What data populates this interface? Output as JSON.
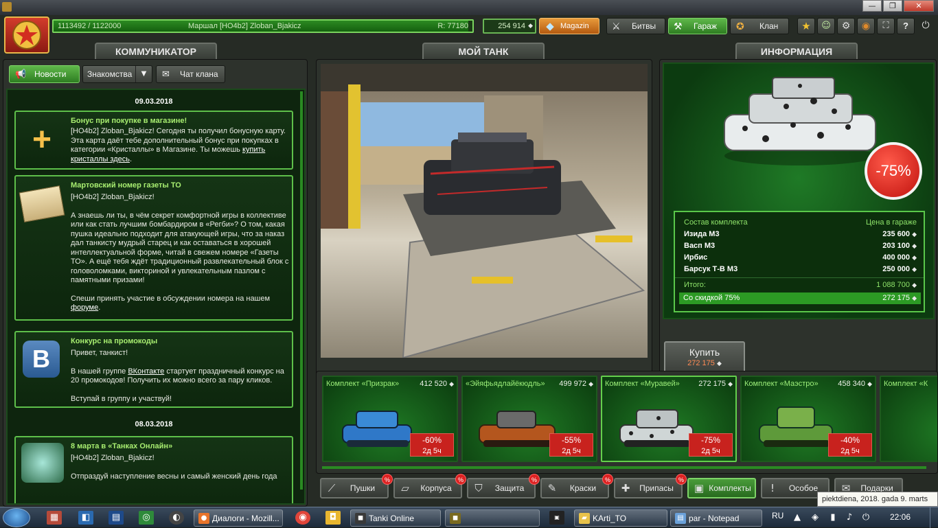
{
  "window": {
    "min_glyph": "—",
    "max_glyph": "❐",
    "close_glyph": "✕"
  },
  "topbar": {
    "rank_progress": "1113492 / 1122000",
    "rank_name": "Маршал [НО4b2] Zloban_Bjakicz",
    "rating": "R: 77180",
    "crystals": "254 914",
    "shop_label": "Magazin",
    "battles_label": "Битвы",
    "garage_label": "Гараж",
    "clan_label": "Клан",
    "help_label": "?"
  },
  "communicator": {
    "title": "КОММУНИКАТОР",
    "tab_news": "Новости",
    "tab_acquaint": "Знакомства",
    "tab_clanchat": "Чат клана",
    "date1": "09.03.2018",
    "date2": "08.03.2018",
    "news": [
      {
        "title": "Бонус при покупке в магазине!",
        "body": "[НО4b2] Zloban_Bjakicz! Сегодня ты получил бонусную карту. Эта карта даёт тебе дополнительный бонус при покупках в категории «Кристаллы» в Магазине. Ты можешь",
        "link": "купить кристаллы здесь",
        "tail": "."
      },
      {
        "title": "Мартовский номер газеты ТО",
        "line1": "[НО4b2] Zloban_Bjakicz!",
        "body": "А знаешь ли ты, в чём секрет комфортной игры в коллективе или как стать лучшим бомбардиром в «Регби»? О том, какая пушка идеально подходит для атакующей игры, что за наказ дал танкисту мудрый старец и как оставаться в хорошей интеллектуальной форме, читай в свежем номере «Газеты ТО». А ещё тебя ждёт традиционный развлекательный блок с головоломками, викториной и увлекательным пазлом с памятными призами!",
        "body2": "Спеши принять участие в обсуждении номера на нашем",
        "link": "форуме",
        "tail": "."
      },
      {
        "title": "Конкурс на промокоды",
        "line1": "Привет, танкист!",
        "pre": "В нашей группе",
        "link": "ВКонтакте",
        "body": " стартует праздничный конкурс на 20 промокодов! Получить их можно всего за пару кликов.",
        "body2": "Вступай в группу и участвуй!"
      },
      {
        "title": "8 марта в «Танках Онлайн»",
        "line1": "[НО4b2] Zloban_Bjakicz!",
        "body": "Отпраздуй наступление весны и самый женский день года"
      }
    ]
  },
  "mytank": {
    "title": "МОЙ ТАНК"
  },
  "info": {
    "title": "ИНФОРМАЦИЯ",
    "badge": "-75%",
    "col_kit": "Состав комплекта",
    "col_price": "Цена в гараже",
    "items": [
      {
        "name": "Изида М3",
        "price": "235 600"
      },
      {
        "name": "Васп М3",
        "price": "203 100"
      },
      {
        "name": "Ирбис",
        "price": "400 000"
      },
      {
        "name": "Барсук Т-В М3",
        "price": "250 000"
      }
    ],
    "total_label": "Итого:",
    "total": "1 088 700",
    "discount_label": "Со скидкой 75%",
    "discount_total": "272 175",
    "buy_label": "Купить",
    "buy_price": "272 175"
  },
  "kits": [
    {
      "name": "Комплект «Призрак»",
      "price": "412 520",
      "pct": "-60%",
      "time": "2д 5ч",
      "color": "#2f78c8"
    },
    {
      "name": "«Эйяфьядлайёкюдль»",
      "price": "499 972",
      "pct": "-55%",
      "time": "2д 5ч",
      "color": "#b4561e"
    },
    {
      "name": "Комплект «Муравей»",
      "price": "272 175",
      "pct": "-75%",
      "time": "2д 5ч",
      "color": "#cfd6d6"
    },
    {
      "name": "Комплект «Маэстро»",
      "price": "458 340",
      "pct": "-40%",
      "time": "2д 5ч",
      "color": "#5e9a3a"
    },
    {
      "name": "Комплект «К"
    }
  ],
  "categories": [
    {
      "label": "Пушки",
      "icon": "⟋",
      "pct": "%"
    },
    {
      "label": "Корпуса",
      "icon": "▱",
      "pct": "%"
    },
    {
      "label": "Защита",
      "icon": "⛉",
      "pct": "%"
    },
    {
      "label": "Краски",
      "icon": "✎",
      "pct": "%"
    },
    {
      "label": "Припасы",
      "icon": "✚",
      "pct": "%"
    },
    {
      "label": "Комплекты",
      "icon": "▣"
    },
    {
      "label": "Особое",
      "icon": "!"
    },
    {
      "label": "Подарки",
      "icon": "✉"
    }
  ],
  "taskbar": {
    "firefox": "Диалоги - Mozill...",
    "tanki": "Tanki Online",
    "karti": "KArti_TO",
    "notepad": "par - Notepad",
    "lang": "RU",
    "clock": "22:06",
    "tooltip": "piektdiena, 2018. gada 9. marts"
  }
}
